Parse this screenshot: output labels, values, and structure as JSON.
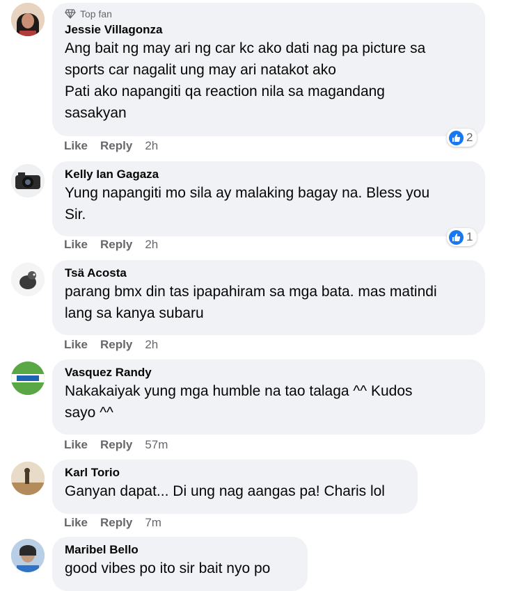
{
  "comments": [
    {
      "badge": "Top fan",
      "author": "Jessie Villagonza",
      "lines": [
        "Ang bait ng may ari ng car kc ako dati nag pa picture sa",
        "sports car nagalit ung may ari natakot ako",
        "Pati ako napangiti qa reaction nila sa magandang",
        "sasakyan"
      ],
      "like_label": "Like",
      "reply_label": "Reply",
      "time": "2h",
      "reaction_count": "2"
    },
    {
      "author": "Kelly Ian Gagaza",
      "lines": [
        "Yung napangiti mo sila ay malaking bagay na. Bless you",
        "Sir."
      ],
      "like_label": "Like",
      "reply_label": "Reply",
      "time": "2h",
      "reaction_count": "1"
    },
    {
      "author": "Tsä Acosta",
      "lines": [
        "parang bmx din tas ipapahiram sa mga bata. mas matindi",
        "lang sa kanya subaru"
      ],
      "like_label": "Like",
      "reply_label": "Reply",
      "time": "2h"
    },
    {
      "author": "Vasquez Randy",
      "lines": [
        "Nakakaiyak yung mga humble na tao talaga ^^ Kudos",
        "sayo ^^"
      ],
      "like_label": "Like",
      "reply_label": "Reply",
      "time": "57m"
    },
    {
      "author": "Karl Torio",
      "lines": [
        "Ganyan dapat... Di ung nag aangas pa! Charis lol"
      ],
      "like_label": "Like",
      "reply_label": "Reply",
      "time": "7m"
    },
    {
      "author": "Maribel Bello",
      "lines": [
        "good vibes po ito sir bait nyo po"
      ]
    }
  ],
  "colors": {
    "bubble": "#f0f2f5",
    "meta": "#65676b",
    "like_blue": "#1877f2"
  },
  "icons": {
    "top_fan": "diamond-icon",
    "reaction": "like-thumb-icon"
  }
}
